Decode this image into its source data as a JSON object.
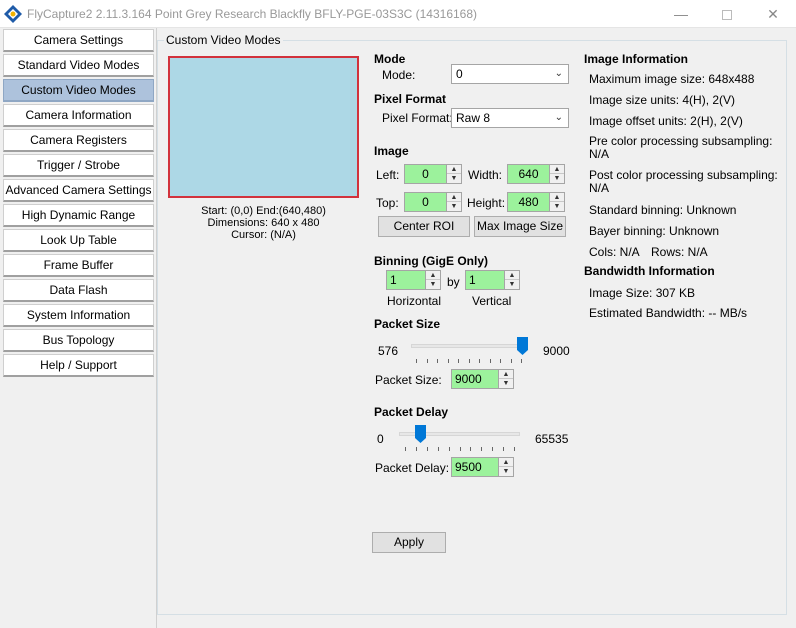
{
  "window": {
    "title": "FlyCapture2 2.11.3.164  Point Grey Research Blackfly BFLY-PGE-03S3C (14316168)",
    "minimize_icon": "minimize-icon",
    "maximize_icon": "maximize-icon",
    "close_icon": "close-icon"
  },
  "sidebar": {
    "items": [
      {
        "label": "Camera Settings",
        "selected": false
      },
      {
        "label": "Standard Video Modes",
        "selected": false
      },
      {
        "label": "Custom Video Modes",
        "selected": true
      },
      {
        "label": "Camera Information",
        "selected": false
      },
      {
        "label": "Camera Registers",
        "selected": false
      },
      {
        "label": "Trigger / Strobe",
        "selected": false
      },
      {
        "label": "Advanced Camera Settings",
        "selected": false
      },
      {
        "label": "High Dynamic Range",
        "selected": false
      },
      {
        "label": "Look Up Table",
        "selected": false
      },
      {
        "label": "Frame Buffer",
        "selected": false
      },
      {
        "label": "Data Flash",
        "selected": false
      },
      {
        "label": "System Information",
        "selected": false
      },
      {
        "label": "Bus Topology",
        "selected": false
      },
      {
        "label": "Help / Support",
        "selected": false
      }
    ]
  },
  "group": {
    "title": "Custom Video Modes"
  },
  "preview": {
    "fill_color": "#add8e6",
    "border_color": "#d2323c",
    "start_end": "Start: (0,0) End:(640,480)",
    "dimensions": "Dimensions: 640 x 480",
    "cursor": "Cursor: (N/A)"
  },
  "mode": {
    "header": "Mode",
    "label": "Mode:",
    "value": "0"
  },
  "pixel_format": {
    "header": "Pixel Format",
    "label": "Pixel Format:",
    "value": "Raw 8"
  },
  "image": {
    "header": "Image",
    "left_label": "Left:",
    "left_value": "0",
    "width_label": "Width:",
    "width_value": "640",
    "top_label": "Top:",
    "top_value": "0",
    "height_label": "Height:",
    "height_value": "480",
    "center_roi": "Center ROI",
    "max_image_size": "Max Image Size"
  },
  "binning": {
    "header": "Binning (GigE Only)",
    "horizontal_value": "1",
    "by": "by",
    "vertical_value": "1",
    "horizontal_label": "Horizontal",
    "vertical_label": "Vertical"
  },
  "packet_size": {
    "header": "Packet Size",
    "min": "576",
    "max": "9000",
    "slider_fraction": 1.0,
    "label": "Packet Size:",
    "value": "9000"
  },
  "packet_delay": {
    "header": "Packet Delay",
    "min": "0",
    "max": "65535",
    "slider_fraction": 0.145,
    "label": "Packet Delay:",
    "value": "9500"
  },
  "apply": "Apply",
  "image_info": {
    "header": "Image Information",
    "max_size": "Maximum image size: 648x488",
    "size_units": "Image size units: 4(H), 2(V)",
    "offset_units": "Image offset units: 2(H), 2(V)",
    "pre_color_1": "Pre color processing subsampling:",
    "pre_color_2": "N/A",
    "post_color_1": "Post color processing subsampling:",
    "post_color_2": "N/A",
    "std_binning": "Standard binning: Unknown",
    "bayer_binning": "Bayer binning: Unknown",
    "cols": "Cols: N/A",
    "rows": "Rows: N/A"
  },
  "bandwidth_info": {
    "header": "Bandwidth Information",
    "image_size": "Image Size: 307 KB",
    "estimated": "Estimated Bandwidth: -- MB/s"
  },
  "colors": {
    "spin_fill": "#9cf29c",
    "selected_tab": "#adc2dc",
    "slider_thumb": "#0078d7"
  }
}
